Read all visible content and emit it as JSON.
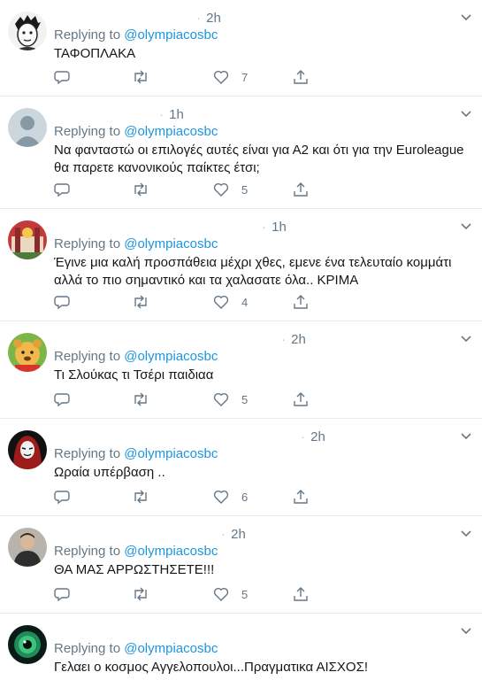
{
  "tweets": [
    {
      "reply_label": "Replying to",
      "handle": "@olympiacosbc",
      "time": "2h",
      "text": "ΤΑΦΟΠΛΑΚΑ",
      "likes": "7",
      "avatar": "cartoon-face"
    },
    {
      "reply_label": "Replying to",
      "handle": "@olympiacosbc",
      "time": "1h",
      "text": "Να φανταστώ οι επιλογές αυτές είναι για Α2 και ότι για την Euroleague θα παρετε κανονικούς παίκτες έτσι;",
      "likes": "5",
      "avatar": "default-silhouette"
    },
    {
      "reply_label": "Replying to",
      "handle": "@olympiacosbc",
      "time": "1h",
      "text": "Έγινε μια καλή προσπάθεια μέχρι χθες, εμενε ένα τελευταίο κομμάτι αλλά το πιο σημαντικό και τα χαλασατε όλα.. ΚΡΙΜΑ",
      "likes": "4",
      "avatar": "red-photo"
    },
    {
      "reply_label": "Replying to",
      "handle": "@olympiacosbc",
      "time": "2h",
      "text": "Τι Σλούκας τι Τσέρι παιδιαα",
      "likes": "5",
      "avatar": "cartoon-bear"
    },
    {
      "reply_label": "Replying to",
      "handle": "@olympiacosbc",
      "time": "2h",
      "text": "Ωραία υπέρβαση ..",
      "likes": "6",
      "avatar": "hooded-mask"
    },
    {
      "reply_label": "Replying to",
      "handle": "@olympiacosbc",
      "time": "2h",
      "text": "ΘΑ ΜΑΣ ΑΡΡΩΣΤΗΣΕΤΕ!!!",
      "likes": "5",
      "avatar": "person-photo"
    },
    {
      "reply_label": "Replying to",
      "handle": "@olympiacosbc",
      "time": "",
      "text": "Γελαει ο κοσμος Αγγελοπουλοι...Πραγματικα ΑΙΣΧΟΣ!",
      "likes": "",
      "avatar": "green-eye"
    }
  ],
  "colors": {
    "link": "#1b95e0",
    "muted": "#657786",
    "divider": "#e6ecf0",
    "text": "#14171a"
  }
}
